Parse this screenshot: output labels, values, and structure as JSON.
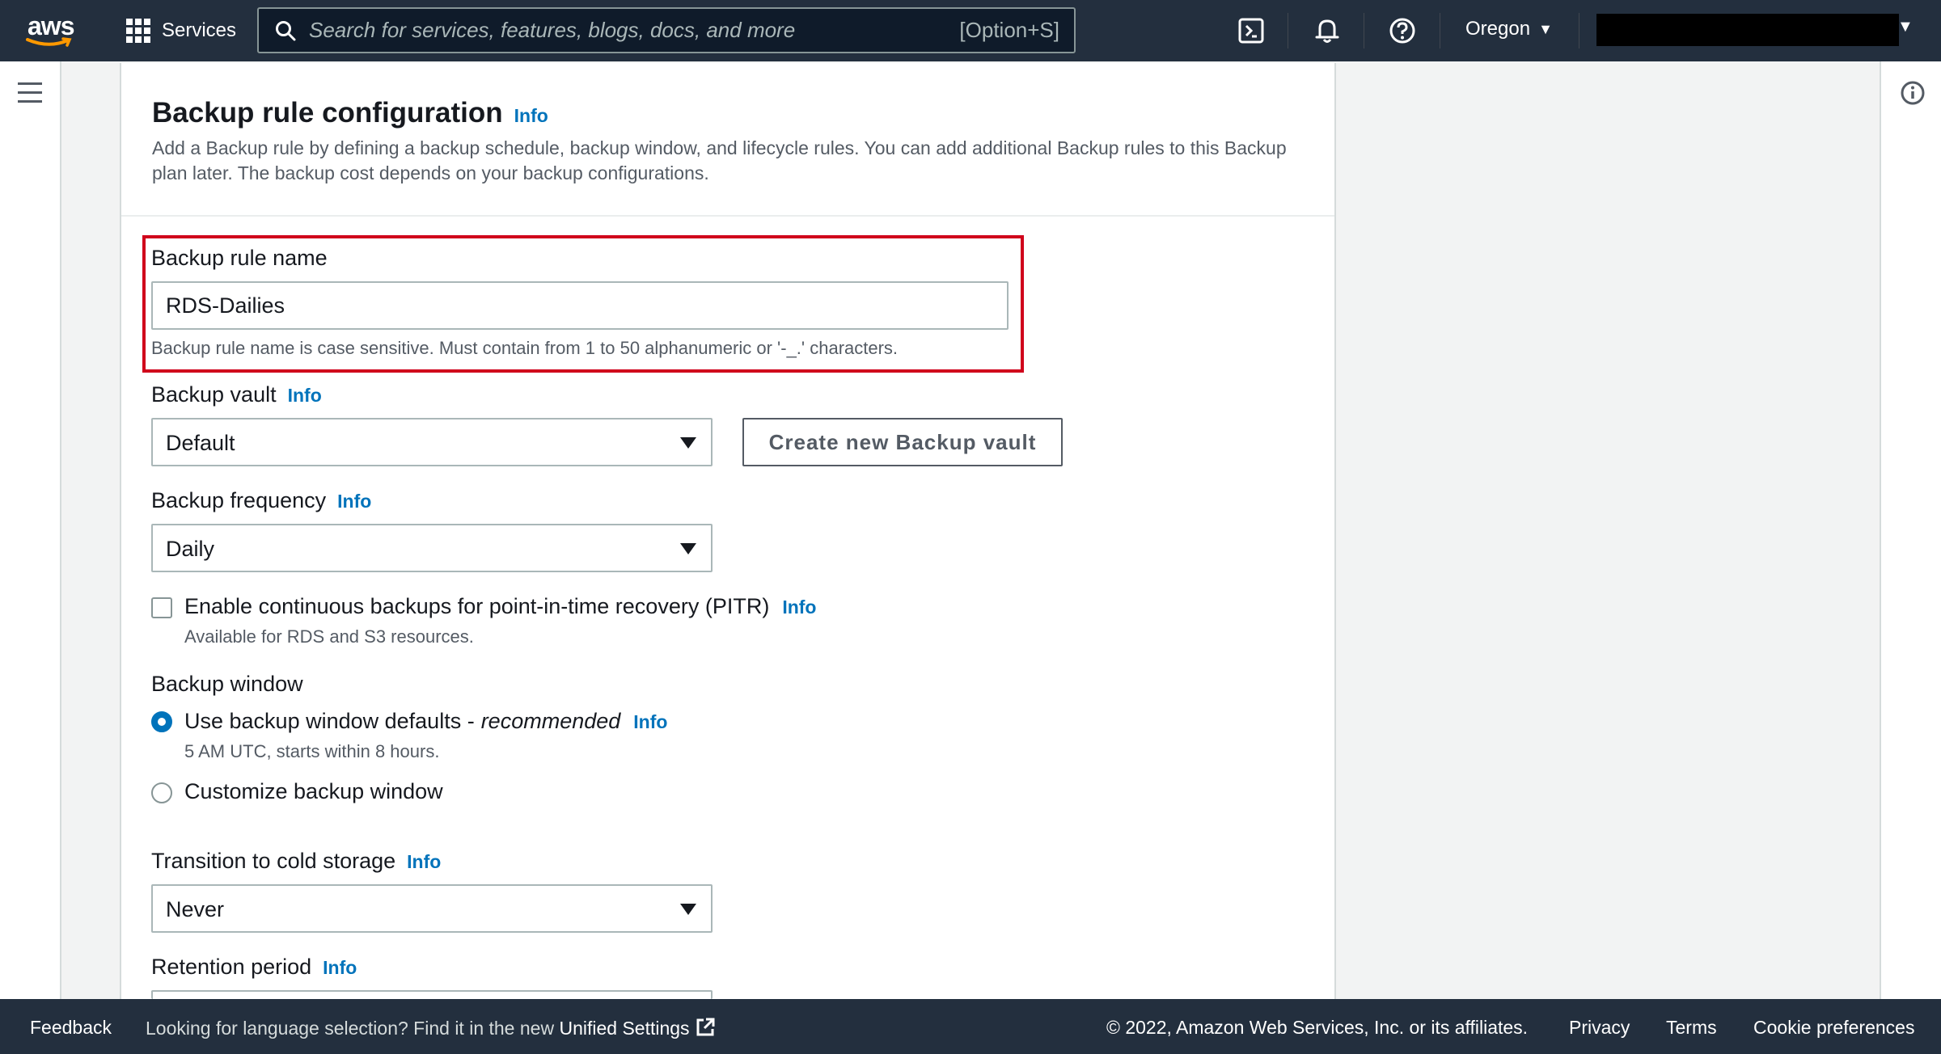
{
  "topnav": {
    "logo_text": "aws",
    "services_label": "Services",
    "search_placeholder": "Search for services, features, blogs, docs, and more",
    "search_shortcut": "[Option+S]",
    "region_label": "Oregon"
  },
  "panel": {
    "title": "Backup rule configuration",
    "title_info": "Info",
    "description": "Add a Backup rule by defining a backup schedule, backup window, and lifecycle rules. You can add additional Backup rules to this Backup plan later. The backup cost depends on your backup configurations."
  },
  "form": {
    "rule_name_label": "Backup rule name",
    "rule_name_value": "RDS-Dailies",
    "rule_name_hint": "Backup rule name is case sensitive. Must contain from 1 to 50 alphanumeric or '-_.' characters.",
    "vault_label": "Backup vault",
    "vault_info": "Info",
    "vault_value": "Default",
    "create_vault_button": "Create new Backup vault",
    "frequency_label": "Backup frequency",
    "frequency_info": "Info",
    "frequency_value": "Daily",
    "pitr_label": "Enable continuous backups for point-in-time recovery (PITR)",
    "pitr_info": "Info",
    "pitr_hint": "Available for RDS and S3 resources.",
    "window_label": "Backup window",
    "window_default_label": "Use backup window defaults -",
    "window_default_em": "recommended",
    "window_default_info": "Info",
    "window_default_hint": "5 AM UTC, starts within 8 hours.",
    "window_custom_label": "Customize backup window",
    "cold_label": "Transition to cold storage",
    "cold_info": "Info",
    "cold_value": "Never",
    "retention_label": "Retention period",
    "retention_info": "Info"
  },
  "footer": {
    "feedback": "Feedback",
    "language_prompt": "Looking for language selection? Find it in the new",
    "unified_settings": "Unified Settings",
    "copyright": "© 2022, Amazon Web Services, Inc. or its affiliates.",
    "privacy": "Privacy",
    "terms": "Terms",
    "cookie": "Cookie preferences"
  },
  "colors": {
    "nav_bg": "#232f3e",
    "link": "#0073bb",
    "highlight": "#d0021b"
  }
}
